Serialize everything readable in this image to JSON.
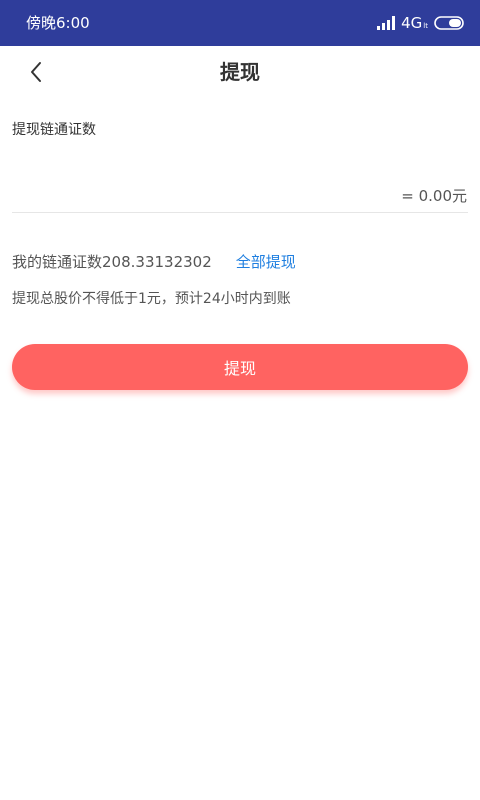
{
  "status_bar": {
    "time": "傍晚6:00",
    "network": "4G",
    "network_sub": "lt",
    "icons": [
      "signal-icon",
      "battery-icon"
    ],
    "background_color": "#2f3d9b"
  },
  "nav": {
    "back_icon": "chevron-left-icon",
    "title": "提现"
  },
  "form": {
    "amount_label": "提现链通证数",
    "amount_value": "",
    "amount_placeholder": "",
    "converted_value": "= 0.00元",
    "balance_text": "我的链通证数208.33132302",
    "withdraw_all_label": "全部提现",
    "notice": "提现总股价不得低于1元，预计24小时内到账"
  },
  "submit": {
    "label": "提现",
    "color": "#ff6361"
  },
  "colors": {
    "link": "#1f7fe0",
    "text": "#333333",
    "divider": "#e6e6e6"
  }
}
